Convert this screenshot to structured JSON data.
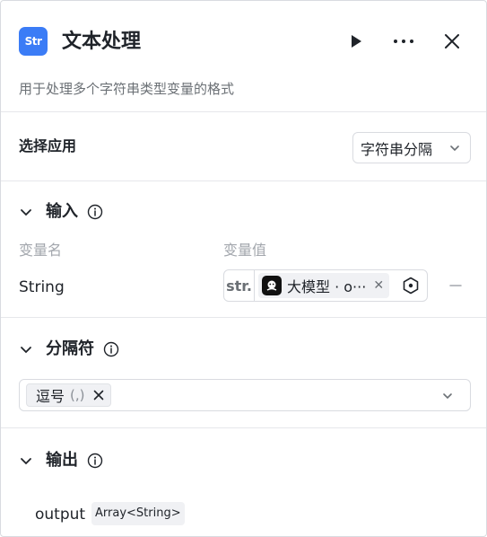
{
  "header": {
    "icon_text": "Str",
    "title": "文本处理",
    "description": "用于处理多个字符串类型变量的格式"
  },
  "apply": {
    "label": "选择应用",
    "selected": "字符串分隔"
  },
  "input": {
    "section_label": "输入",
    "col_name": "变量名",
    "col_value": "变量值",
    "rows": [
      {
        "name": "String",
        "type_tag": "str.",
        "ref_text": "大模型 · o···"
      }
    ]
  },
  "delimiter": {
    "section_label": "分隔符",
    "tag_label": "逗号",
    "tag_symbol": "(,)"
  },
  "output": {
    "section_label": "输出",
    "name": "output",
    "type": "Array<String>"
  },
  "colors": {
    "accent": "#3b7cf6",
    "border": "#d9dbe0",
    "muted_text": "#a3a7ad"
  }
}
